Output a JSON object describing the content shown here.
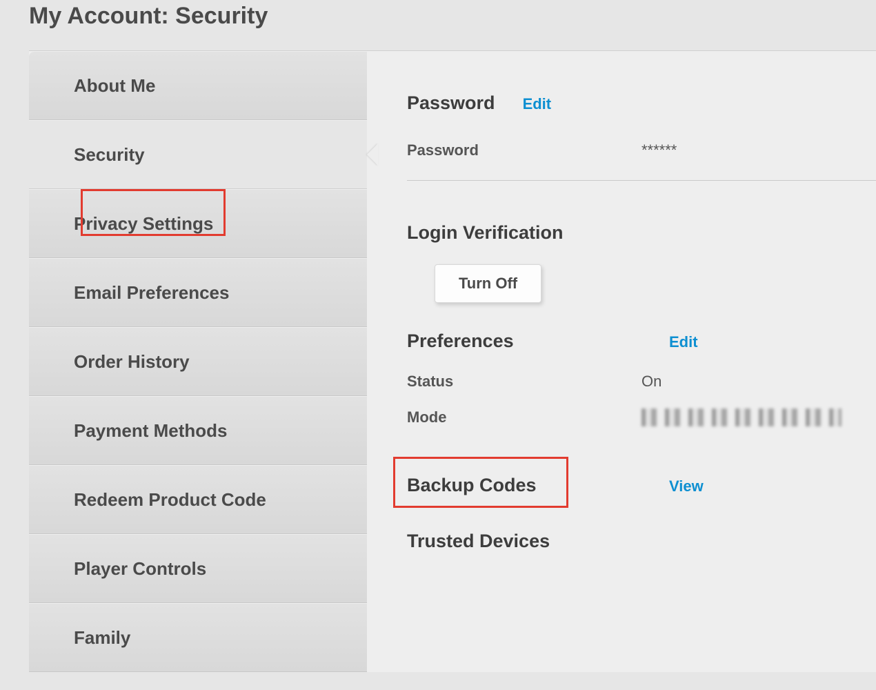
{
  "page": {
    "title": "My Account: Security"
  },
  "sidebar": {
    "items": [
      {
        "label": "About Me"
      },
      {
        "label": "Security"
      },
      {
        "label": "Privacy Settings"
      },
      {
        "label": "Email Preferences"
      },
      {
        "label": "Order History"
      },
      {
        "label": "Payment Methods"
      },
      {
        "label": "Redeem Product Code"
      },
      {
        "label": "Player Controls"
      },
      {
        "label": "Family"
      }
    ]
  },
  "content": {
    "password": {
      "title": "Password",
      "edit": "Edit",
      "field_label": "Password",
      "field_value": "******"
    },
    "login_verification": {
      "title": "Login Verification",
      "turn_off": "Turn Off",
      "preferences": {
        "title": "Preferences",
        "edit": "Edit",
        "status_label": "Status",
        "status_value": "On",
        "mode_label": "Mode"
      }
    },
    "backup_codes": {
      "title": "Backup Codes",
      "view": "View"
    },
    "trusted_devices": {
      "title": "Trusted Devices"
    }
  }
}
